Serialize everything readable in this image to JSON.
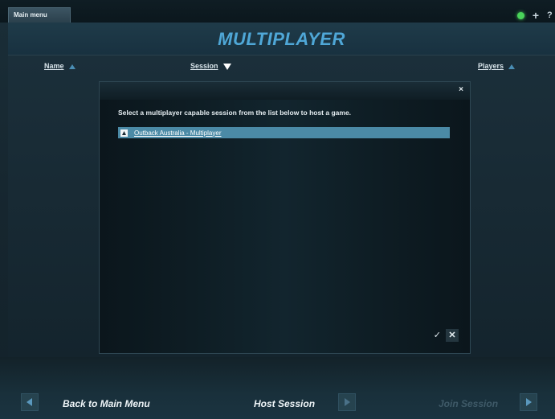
{
  "top_tab": {
    "label": "Main menu"
  },
  "system_icons": {
    "status": "green-dot",
    "add": "+",
    "help": "?"
  },
  "header": {
    "title": "MULTIPLAYER"
  },
  "columns": {
    "name": "Name",
    "session": "Session",
    "players": "Players"
  },
  "dialog": {
    "close_glyph": "×",
    "instruction": "Select a multiplayer capable session from the list below to host a game.",
    "sessions": [
      {
        "label": "Outback Australia - Multiplayer",
        "selected": true
      }
    ],
    "ok_glyph": "✓",
    "cancel_glyph": "✕"
  },
  "footer": {
    "back_label": "Back to Main Menu",
    "host_label": "Host Session",
    "join_label": "Join Session"
  },
  "colors": {
    "accent": "#4fa7d7",
    "selection": "#4b8aa6",
    "status_online": "#49d35a"
  }
}
